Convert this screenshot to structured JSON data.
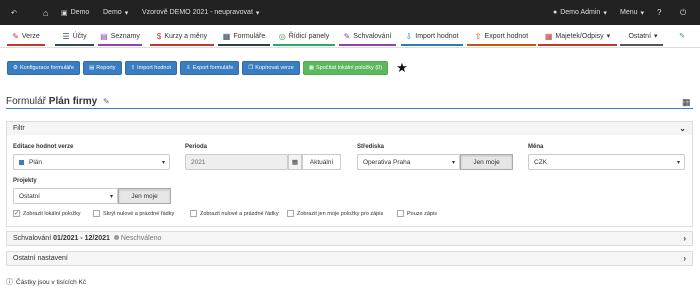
{
  "topbar": {
    "demo_link": "Demo",
    "demo_menu": "Demo",
    "scenario": "Vzorově DEMO 2021 - neupravovat",
    "user": "Demo Admin",
    "menu": "Menu"
  },
  "tabs": [
    {
      "label": "Verze",
      "icon": "✎",
      "color": "#c0392b"
    },
    {
      "label": "Účty",
      "icon": "☰",
      "color": "#34495e"
    },
    {
      "label": "Seznamy",
      "icon": "▤",
      "color": "#8e44ad"
    },
    {
      "label": "Kurzy a měny",
      "icon": "$",
      "color": "#c0392b"
    },
    {
      "label": "Formuláře",
      "icon": "▦",
      "color": "#2c3e50"
    },
    {
      "label": "Řídicí panely",
      "icon": "◎",
      "color": "#27ae60"
    },
    {
      "label": "Schvalování",
      "icon": "✎",
      "color": "#8e44ad"
    },
    {
      "label": "Import hodnot",
      "icon": "⇩",
      "color": "#2980b9"
    },
    {
      "label": "Export hodnot",
      "icon": "⇧",
      "color": "#d35400"
    },
    {
      "label": "Majetek/Odpisy",
      "icon": "▦",
      "color": "#c0392b"
    },
    {
      "label": "Ostatní",
      "icon": "",
      "color": "#555555"
    }
  ],
  "actions": {
    "config": "Konfigurace formuláře",
    "reports": "Reporty",
    "import": "Import hodnot",
    "export": "Export formuláře",
    "copy": "Kopírovat verze",
    "calc": "Spočítat lokální položky (0)"
  },
  "form": {
    "prefix": "Formulář",
    "name": "Plán firmy"
  },
  "filter": {
    "title": "Filtr",
    "version_label": "Editace hodnot verze",
    "version_value": "Plán",
    "period_label": "Perioda",
    "period_value": "2021",
    "period_btn": "Aktuální",
    "center_label": "Střediska",
    "center_value": "Operativa Praha",
    "center_btn": "Jen moje",
    "currency_label": "Měna",
    "currency_value": "CZK",
    "projects_label": "Projekty",
    "projects_value": "Ostatní",
    "projects_btn": "Jen moje",
    "checks": [
      {
        "label": "Zobrazit lokální položky",
        "checked": true
      },
      {
        "label": "Skrýt nulové a prázdné řádky",
        "checked": false
      },
      {
        "label": "Zobrazit nulové a prázdné řádky",
        "checked": false
      },
      {
        "label": "Zobrazit jen moje položky pro zápis",
        "checked": false
      },
      {
        "label": "Pouze zápis",
        "checked": false
      }
    ]
  },
  "approval": {
    "label": "Schvalování",
    "period": "01/2021 - 12/2021",
    "status": "Neschváleno"
  },
  "other_settings": "Ostatní nastavení",
  "footnote": "Částky jsou v tisících Kč",
  "colors": {
    "accent": "#3a7dc0",
    "green": "#5cb85c",
    "topbar": "#222222"
  }
}
